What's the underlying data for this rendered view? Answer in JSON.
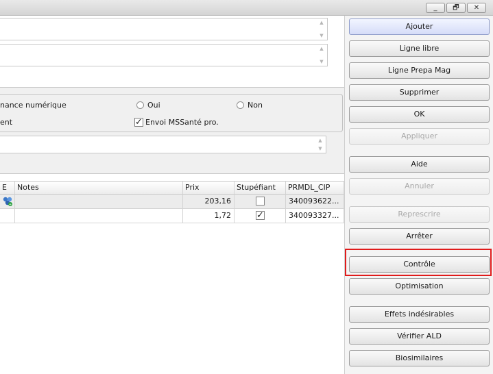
{
  "window": {
    "controls": {
      "minimize": "_",
      "restore": "🗗",
      "close": "✕"
    }
  },
  "form": {
    "radio_label_partial": "nance numérique",
    "radio_oui": "Oui",
    "radio_non": "Non",
    "left_label_partial": "ent",
    "mssante_label": "Envoi MSSanté pro.",
    "mssante_checked": true
  },
  "table": {
    "columns": [
      "E",
      "Notes",
      "Prix",
      "Stupéfiant",
      "PRMDL_CIP"
    ],
    "rows": [
      {
        "e_icon": "molecule-icon",
        "notes": "",
        "prix": "203,16",
        "stupefiant": false,
        "prmdl_cip": "340093622..."
      },
      {
        "e_icon": "",
        "notes": "",
        "prix": "1,72",
        "stupefiant": true,
        "prmdl_cip": "340093327..."
      }
    ]
  },
  "buttons": {
    "ajouter": "Ajouter",
    "ligne_libre": "Ligne libre",
    "ligne_prepa_mag": "Ligne Prepa Mag",
    "supprimer": "Supprimer",
    "ok": "OK",
    "appliquer": "Appliquer",
    "aide": "Aide",
    "annuler": "Annuler",
    "represcrire": "Represcrire",
    "arreter": "Arrêter",
    "controle": "Contrôle",
    "optimisation": "Optimisation",
    "effets_indesirables": "Effets indésirables",
    "verifier_ald": "Vérifier ALD",
    "biosimilaires": "Biosimilaires"
  },
  "colors": {
    "highlight": "#e01b1b",
    "primary_button": "#d5dcf8"
  }
}
